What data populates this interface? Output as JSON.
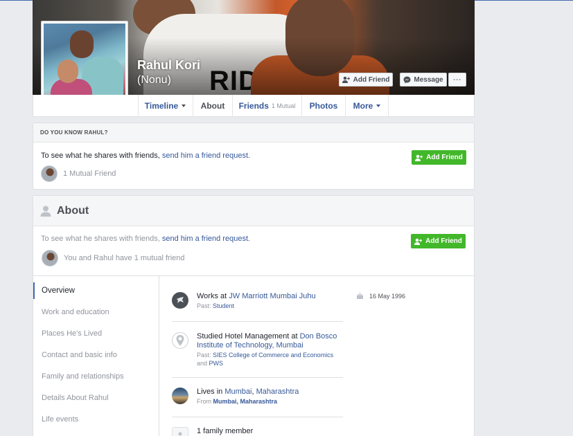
{
  "profile": {
    "name": "Rahul Kori",
    "alternate_name": "(Nonu)"
  },
  "cover_actions": {
    "add_friend": "Add Friend",
    "message": "Message",
    "more": "···"
  },
  "tabs": {
    "timeline": "Timeline",
    "about": "About",
    "friends": "Friends",
    "friends_mutual": "1 Mutual",
    "photos": "Photos",
    "more": "More"
  },
  "know_box": {
    "header": "DO YOU KNOW RAHUL?",
    "sentence_prefix": "To see what he shares with friends,",
    "sentence_link": "send him a friend request.",
    "mutual": "1 Mutual Friend",
    "add_friend": "Add Friend"
  },
  "about": {
    "title": "About",
    "sentence_prefix": "To see what he shares with friends,",
    "sentence_link": "send him a friend request.",
    "mutual": "You and Rahul have 1 mutual friend",
    "add_friend": "Add Friend",
    "nav": [
      "Overview",
      "Work and education",
      "Places He's Lived",
      "Contact and basic info",
      "Family and relationships",
      "Details About Rahul",
      "Life events"
    ],
    "work": {
      "prefix": "Works at",
      "employer": "JW Marriott Mumbai Juhu",
      "past_prefix": "Past:",
      "past": "Student"
    },
    "education": {
      "prefix": "Studied Hotel Management at",
      "school": "Don Bosco Institute of Technology, Mumbai",
      "past_prefix": "Past:",
      "past_school": "SIES College of Commerce and Economics",
      "past_and": "and",
      "past_school2": "PWS"
    },
    "lives": {
      "prefix": "Lives in",
      "city": "Mumbai",
      "region": "Maharashtra",
      "from_prefix": "From",
      "from": "Mumbai, Maharashtra"
    },
    "family": "1 family member",
    "birthday": "16 May 1996"
  },
  "colors": {
    "link": "#365899",
    "green": "#42b72a",
    "accent": "#4267b2"
  }
}
